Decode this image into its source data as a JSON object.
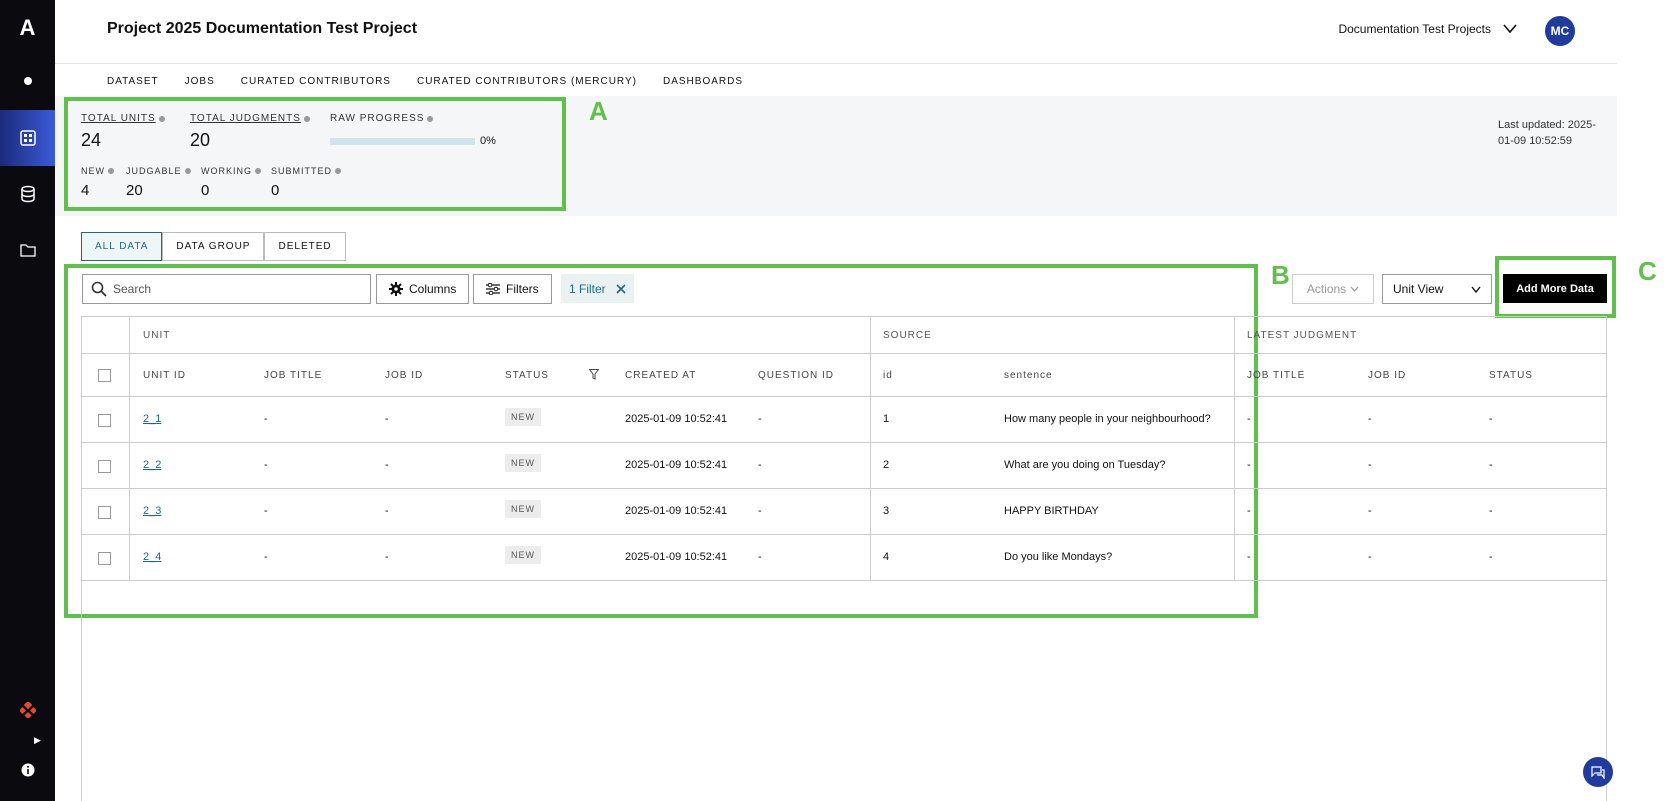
{
  "header": {
    "project_title": "Project 2025 Documentation Test Project",
    "project_switcher": "Documentation Test Projects",
    "avatar_initials": "MC"
  },
  "nav": [
    "DATASET",
    "JOBS",
    "CURATED CONTRIBUTORS",
    "CURATED CONTRIBUTORS (MERCURY)",
    "DASHBOARDS"
  ],
  "stats": {
    "total_units_label": "TOTAL UNITS",
    "total_units": "24",
    "total_judgments_label": "TOTAL JUDGMENTS",
    "total_judgments": "20",
    "raw_progress_label": "RAW PROGRESS",
    "raw_progress_pct": "0%",
    "raw_progress_fraction": 0,
    "new_label": "NEW",
    "new": "4",
    "judgable_label": "JUDGABLE",
    "judgable": "20",
    "working_label": "WORKING",
    "working": "0",
    "submitted_label": "SUBMITTED",
    "submitted": "0",
    "last_updated": "Last updated: 2025-01-09 10:52:59"
  },
  "annotations": {
    "a": "A",
    "b": "B",
    "c": "C"
  },
  "tabs": [
    "ALL DATA",
    "DATA GROUP",
    "DELETED"
  ],
  "toolbar": {
    "search_placeholder": "Search",
    "columns": "Columns",
    "filters": "Filters",
    "filter_chip": "1 Filter",
    "actions": "Actions",
    "unit_view": "Unit View",
    "add_more_data": "Add More Data"
  },
  "table": {
    "groups": [
      "UNIT",
      "SOURCE",
      "LATEST JUDGMENT"
    ],
    "columns": [
      "UNIT ID",
      "JOB TITLE",
      "JOB ID",
      "STATUS",
      "CREATED AT",
      "QUESTION ID",
      "id",
      "sentence",
      "JOB TITLE",
      "JOB ID",
      "STATUS"
    ],
    "rows": [
      {
        "unit_id": "2_1",
        "job_title": "-",
        "job_id": "-",
        "status": "NEW",
        "created_at": "2025-01-09 10:52:41",
        "question_id": "-",
        "id": "1",
        "sentence": "How many people in your neighbourhood?",
        "lj_title": "-",
        "lj_job_id": "-",
        "lj_status": "-"
      },
      {
        "unit_id": "2_2",
        "job_title": "-",
        "job_id": "-",
        "status": "NEW",
        "created_at": "2025-01-09 10:52:41",
        "question_id": "-",
        "id": "2",
        "sentence": "What are you doing on Tuesday?",
        "lj_title": "-",
        "lj_job_id": "-",
        "lj_status": "-"
      },
      {
        "unit_id": "2_3",
        "job_title": "-",
        "job_id": "-",
        "status": "NEW",
        "created_at": "2025-01-09 10:52:41",
        "question_id": "-",
        "id": "3",
        "sentence": "HAPPY BIRTHDAY",
        "lj_title": "-",
        "lj_job_id": "-",
        "lj_status": "-"
      },
      {
        "unit_id": "2_4",
        "job_title": "-",
        "job_id": "-",
        "status": "NEW",
        "created_at": "2025-01-09 10:52:41",
        "question_id": "-",
        "id": "4",
        "sentence": "Do you like Mondays?",
        "lj_title": "-",
        "lj_job_id": "-",
        "lj_status": "-"
      }
    ]
  },
  "colors": {
    "accent": "#1d6b80",
    "annotation": "#5ec24a",
    "sidebar": "#0b0b0f",
    "avatar": "#1f3b9e"
  }
}
